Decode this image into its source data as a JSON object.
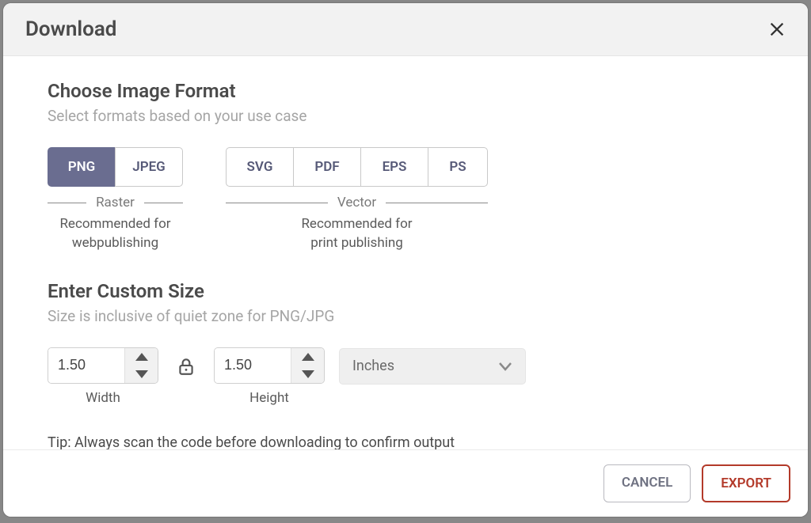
{
  "dialog": {
    "title": "Download",
    "close_icon": "close-icon"
  },
  "format_section": {
    "title": "Choose Image Format",
    "subtitle": "Select formats based on your use case",
    "raster": {
      "label": "Raster",
      "recommendation": "Recommended for web publishing",
      "options": [
        "PNG",
        "JPEG"
      ],
      "selected": "PNG"
    },
    "vector": {
      "label": "Vector",
      "recommendation": "Recommended for print publishing",
      "options": [
        "SVG",
        "PDF",
        "EPS",
        "PS"
      ],
      "selected": null
    }
  },
  "size_section": {
    "title": "Enter Custom Size",
    "subtitle": "Size is inclusive of quiet zone for PNG/JPG",
    "width": {
      "label": "Width",
      "value": "1.50"
    },
    "height": {
      "label": "Height",
      "value": "1.50"
    },
    "locked": true,
    "unit": "Inches"
  },
  "tip": "Tip: Always scan the code before downloading to confirm output",
  "footer": {
    "cancel": "CANCEL",
    "export": "EXPORT"
  }
}
